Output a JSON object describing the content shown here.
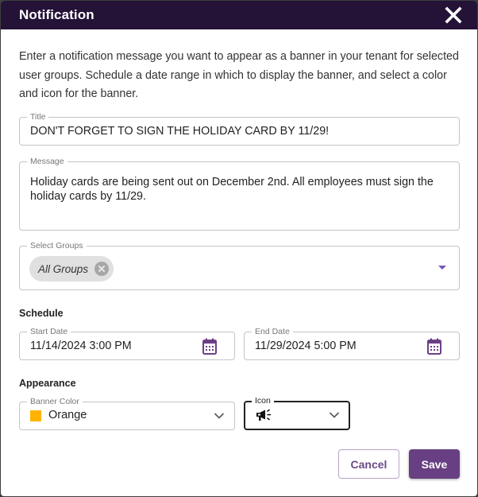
{
  "dialog": {
    "title": "Notification",
    "close_icon": "close-icon",
    "intro": "Enter a notification message you want to appear as a banner in your tenant for selected user groups. Schedule a date range in which to display the banner, and select a color and icon for the banner."
  },
  "fields": {
    "title": {
      "label": "Title",
      "value": "DON'T FORGET TO SIGN THE HOLIDAY CARD BY 11/29!"
    },
    "message": {
      "label": "Message",
      "value": "Holiday cards are being sent out on December 2nd. All employees must sign the holiday cards by 11/29."
    },
    "groups": {
      "label": "Select Groups",
      "chips": [
        "All Groups"
      ],
      "dropdown_icon": "caret-down-icon"
    }
  },
  "schedule": {
    "heading": "Schedule",
    "start": {
      "label": "Start Date",
      "value": "11/14/2024 3:00 PM",
      "icon": "calendar-icon"
    },
    "end": {
      "label": "End Date",
      "value": "11/29/2024 5:00 PM",
      "icon": "calendar-icon"
    }
  },
  "appearance": {
    "heading": "Appearance",
    "banner_color": {
      "label": "Banner Color",
      "value": "Orange",
      "swatch": "#FFB300"
    },
    "icon": {
      "label": "Icon",
      "value": "megaphone-icon"
    }
  },
  "actions": {
    "cancel": "Cancel",
    "save": "Save"
  },
  "colors": {
    "header_bg": "#241337",
    "accent": "#683F82",
    "calendar": "#6B3F86",
    "dropdown_caret": "#7653B6"
  }
}
